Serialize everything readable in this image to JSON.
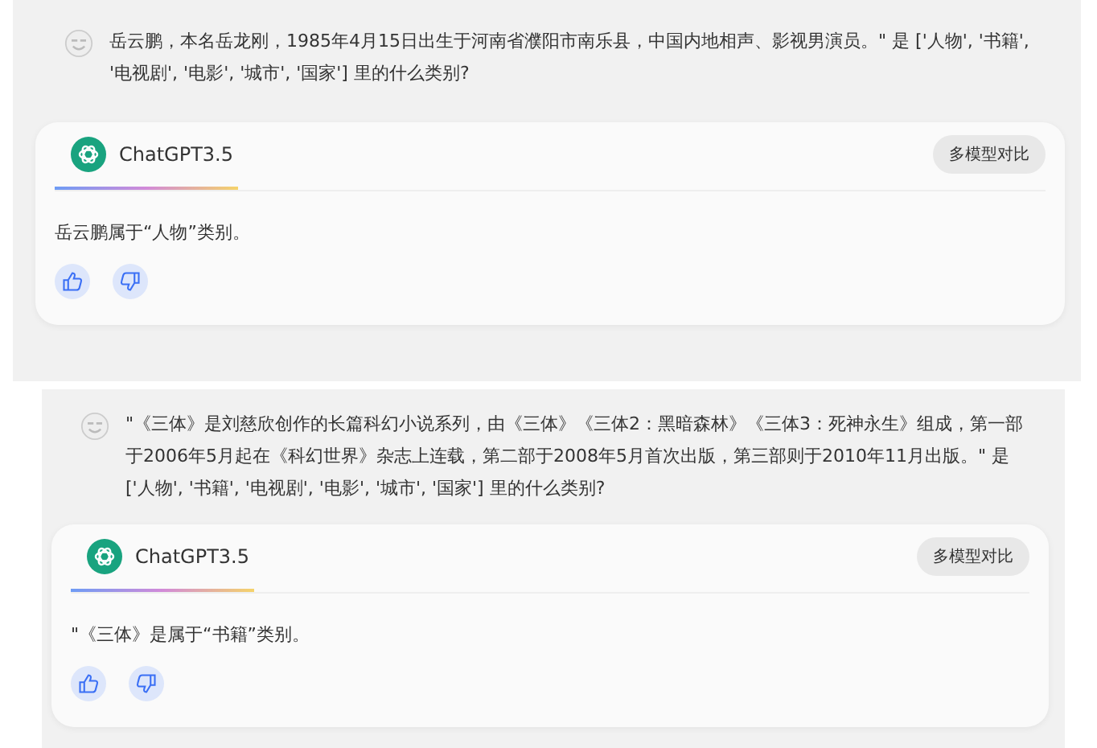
{
  "conversations": [
    {
      "question": "岳云鹏，本名岳龙刚，1985年4月15日出生于河南省濮阳市南乐县，中国内地相声、影视男演员。\" 是 ['人物', '书籍', '电视剧', '电影', '城市', '国家'] 里的什么类别?",
      "model": "ChatGPT3.5",
      "compare_button": "多模型对比",
      "answer": "岳云鹏属于“人物”类别。"
    },
    {
      "question": "\"《三体》是刘慈欣创作的长篇科幻小说系列，由《三体》《三体2：黑暗森林》《三体3：死神永生》组成，第一部于2006年5月起在《科幻世界》杂志上连载，第二部于2008年5月首次出版，第三部则于2010年11月出版。\" 是 ['人物', '书籍', '电视剧', '电影', '城市', '国家'] 里的什么类别?",
      "model": "ChatGPT3.5",
      "compare_button": "多模型对比",
      "answer": "\"《三体》是属于“书籍”类别。"
    }
  ]
}
